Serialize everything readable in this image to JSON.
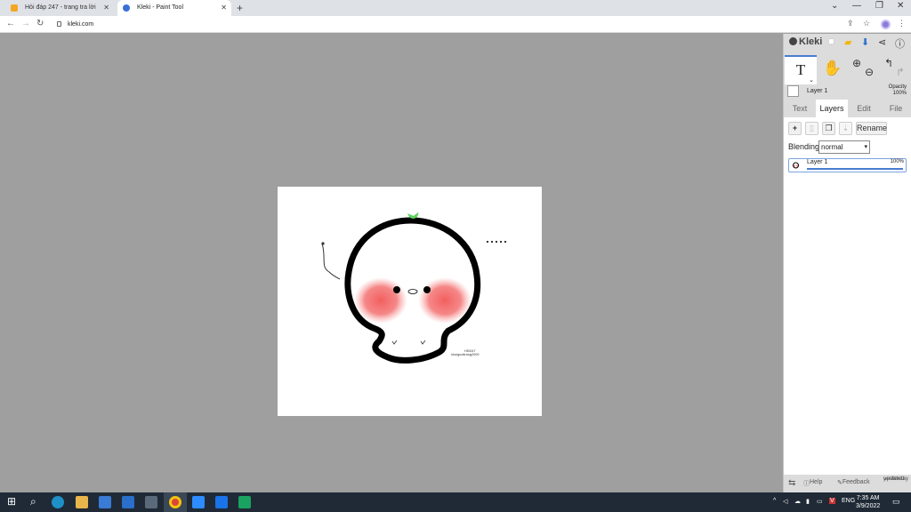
{
  "browser": {
    "tabs": [
      {
        "title": "Hỏi đáp 247 - trang tra lời",
        "active": false,
        "favicon_color": "#f5a623"
      },
      {
        "title": "Kleki - Paint Tool",
        "active": true,
        "favicon_color": "#3b6fd6"
      }
    ],
    "new_tab": "+",
    "url": "kleki.com"
  },
  "app": {
    "logo": "Kleki",
    "tools": {
      "text_tool": "T",
      "caret": "⌄"
    },
    "current_layer": {
      "name": "Layer 1",
      "opacity_label": "Opacity",
      "opacity_value": "100%"
    },
    "tabs": [
      "Text",
      "Layers",
      "Edit",
      "File"
    ],
    "active_tab": "Layers",
    "layers_panel": {
      "add": "+",
      "rename": "Rename",
      "blending_label": "Blending",
      "blending_value": "normal",
      "layers": [
        {
          "name": "Layer 1",
          "opacity": "100%",
          "opacity_fraction": 1.0
        }
      ]
    },
    "footer": {
      "help": "Help",
      "feedback": "Feedback",
      "updated": "updated",
      "updated_when": "yesterday"
    }
  },
  "canvas": {
    "signature_line1": "HDD47",
    "signature_line2": "nlonguoitrang2009"
  },
  "taskbar": {
    "language": "ENG",
    "time": "7:35 AM",
    "date": "3/9/2022"
  }
}
